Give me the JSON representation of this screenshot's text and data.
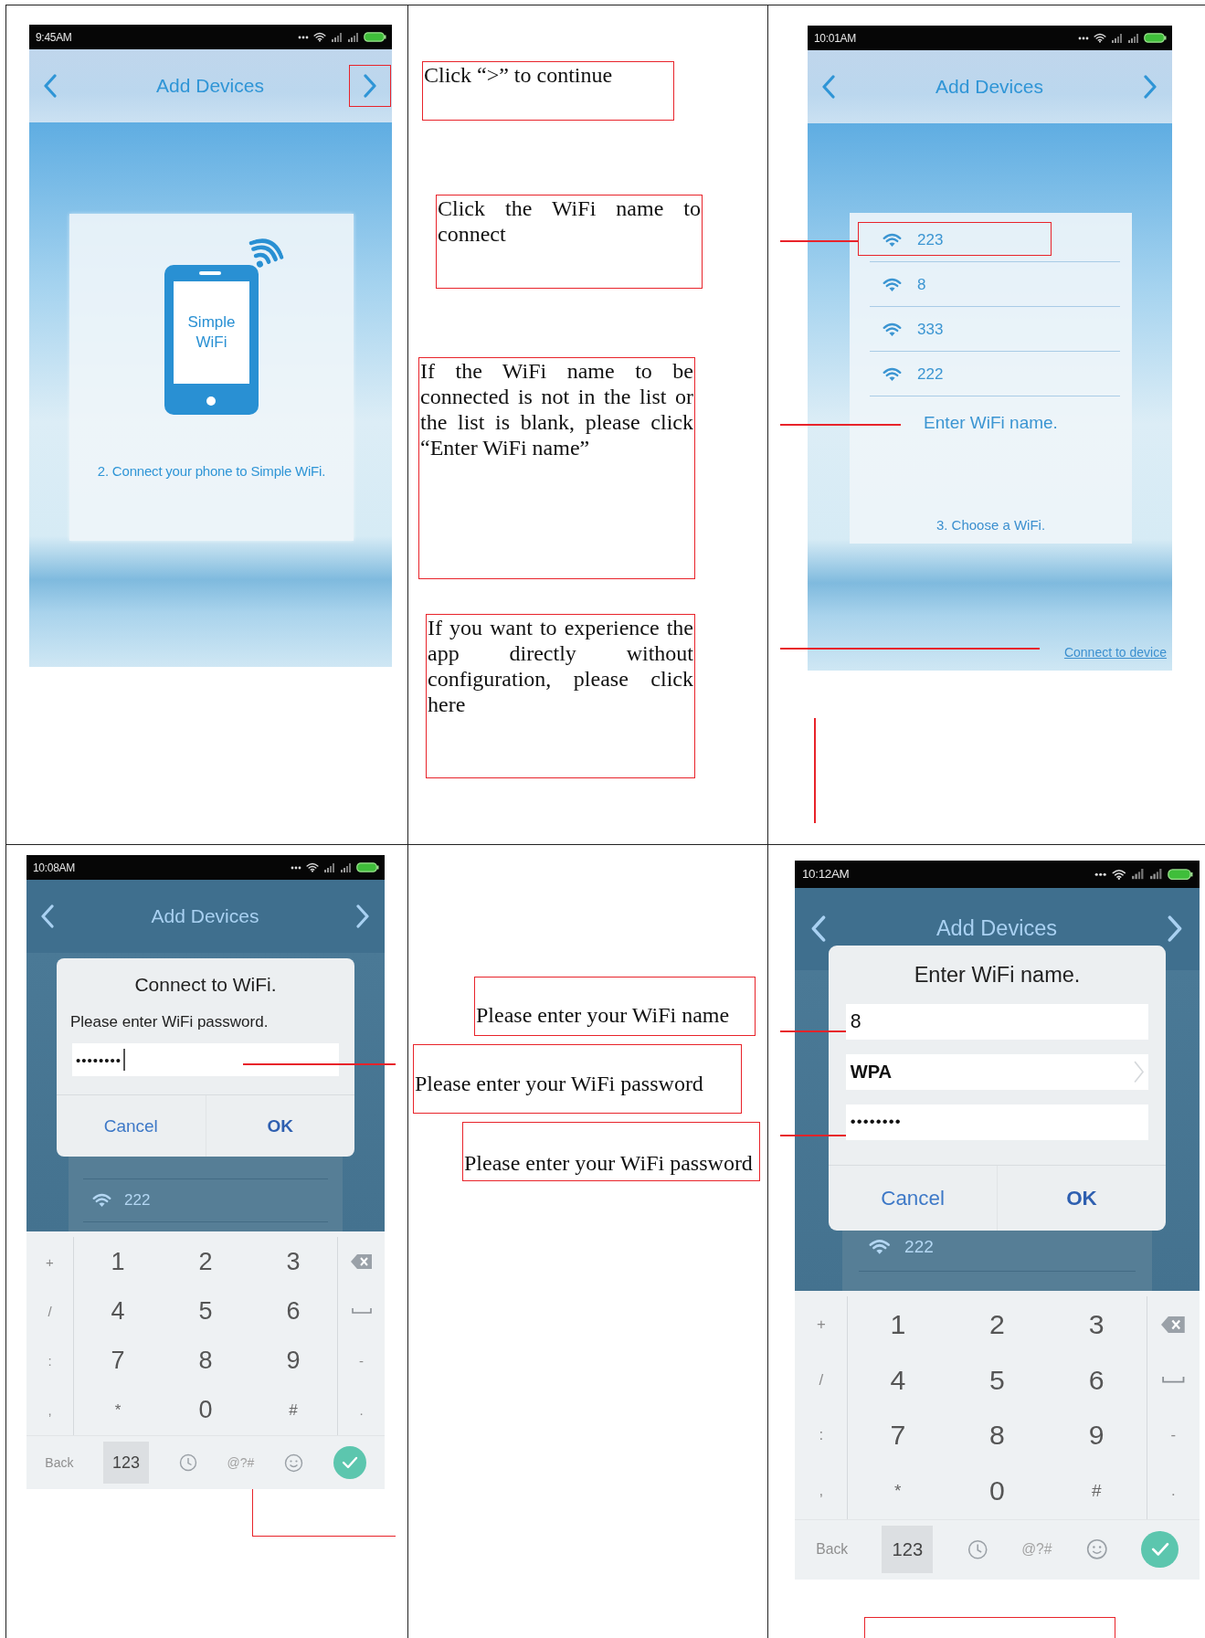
{
  "rows": [
    {
      "screens": [
        {
          "kind": "intro",
          "status_time": "9:45AM",
          "title": "Add Devices",
          "next_highlighted": true,
          "illustration_text": [
            "Simple",
            "WiFi"
          ],
          "caption": "2. Connect your phone to Simple WiFi."
        },
        {
          "kind": "wifi_list",
          "status_time": "10:01AM",
          "title": "Add Devices",
          "next_highlighted": false,
          "networks": [
            {
              "name": "223",
              "highlighted": true
            },
            {
              "name": "8",
              "highlighted": false
            },
            {
              "name": "333",
              "highlighted": false
            },
            {
              "name": "222",
              "highlighted": false
            }
          ],
          "enter_link": "Enter WiFi name.",
          "caption": "3. Choose a WiFi.",
          "connect_link": "Connect to device"
        }
      ],
      "notes": [
        "Click “>” to continue",
        "Click the WiFi name to connect",
        "If the WiFi name to be connected is not in the list or the list is blank, please click “Enter WiFi name”",
        "If you want to experience the app directly without configuration, please click here"
      ]
    },
    {
      "screens": [
        {
          "kind": "password_dialog",
          "status_time": "10:08AM",
          "title": "Add Devices",
          "next_highlighted": false,
          "background_networks": [
            "222"
          ],
          "dialog": {
            "title": "Connect to WiFi.",
            "message": "Please enter WiFi password.",
            "password": "••••••••",
            "cancel": "Cancel",
            "ok": "OK"
          },
          "keyboard": {
            "left_keys": [
              "+",
              "/",
              ":",
              ","
            ],
            "digit_keys": [
              "1",
              "2",
              "3",
              "4",
              "5",
              "6",
              "7",
              "8",
              "9",
              "*",
              "0",
              "#"
            ],
            "right_keys": [
              {
                "kind": "backspace"
              },
              {
                "kind": "space"
              },
              {
                "kind": "text",
                "label": "-"
              },
              {
                "kind": "text",
                "label": "."
              }
            ],
            "back_label": "Back",
            "mode_label": "123",
            "symbol_label": "@?#"
          }
        },
        {
          "kind": "name_dialog",
          "status_time": "10:12AM",
          "title": "Add Devices",
          "next_highlighted": false,
          "background_networks": [
            "222"
          ],
          "dialog": {
            "title": "Enter WiFi name.",
            "name": "8",
            "security": "WPA",
            "password": "••••••••",
            "cancel": "Cancel",
            "ok": "OK"
          },
          "keyboard": {
            "left_keys": [
              "+",
              "/",
              ":",
              ","
            ],
            "digit_keys": [
              "1",
              "2",
              "3",
              "4",
              "5",
              "6",
              "7",
              "8",
              "9",
              "*",
              "0",
              "#"
            ],
            "right_keys": [
              {
                "kind": "backspace"
              },
              {
                "kind": "space"
              },
              {
                "kind": "text",
                "label": "-"
              },
              {
                "kind": "text",
                "label": "."
              }
            ],
            "back_label": "Back",
            "mode_label": "123",
            "symbol_label": "@?#"
          }
        }
      ],
      "notes": [
        "Please enter your WiFi name",
        "Please enter your WiFi password",
        "Please enter your WiFi password"
      ]
    }
  ]
}
